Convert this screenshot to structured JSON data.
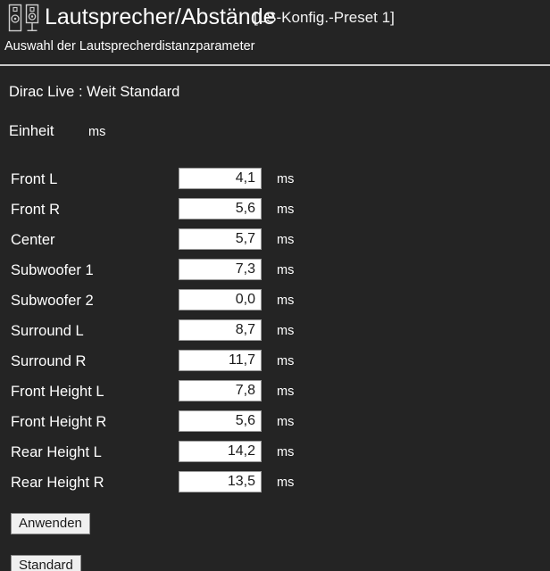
{
  "header": {
    "icon": "speaker-pair-icon",
    "title": "Lautsprecher/Abstände",
    "preset": "[LS-Konfig.-Preset 1]",
    "subtitle": "Auswahl der Lautsprecherdistanzparameter"
  },
  "info": {
    "dirac_line": "Dirac Live : Weit Standard",
    "unit_label": "Einheit",
    "unit_value": "ms"
  },
  "channels": [
    {
      "label": "Front L",
      "value": "4,1",
      "unit": "ms"
    },
    {
      "label": "Front R",
      "value": "5,6",
      "unit": "ms"
    },
    {
      "label": "Center",
      "value": "5,7",
      "unit": "ms"
    },
    {
      "label": "Subwoofer 1",
      "value": "7,3",
      "unit": "ms"
    },
    {
      "label": "Subwoofer 2",
      "value": "0,0",
      "unit": "ms"
    },
    {
      "label": "Surround L",
      "value": "8,7",
      "unit": "ms"
    },
    {
      "label": "Surround R",
      "value": "11,7",
      "unit": "ms"
    },
    {
      "label": "Front Height L",
      "value": "7,8",
      "unit": "ms"
    },
    {
      "label": "Front Height R",
      "value": "5,6",
      "unit": "ms"
    },
    {
      "label": "Rear Height L",
      "value": "14,2",
      "unit": "ms"
    },
    {
      "label": "Rear Height R",
      "value": "13,5",
      "unit": "ms"
    }
  ],
  "buttons": {
    "apply": "Anwenden",
    "default": "Standard"
  },
  "colors": {
    "background": "#242424",
    "text": "#ffffff",
    "rule": "#c8c8c8",
    "input_background": "#ffffff",
    "input_text": "#1a1a1a",
    "button_background": "#f0f0f0"
  }
}
